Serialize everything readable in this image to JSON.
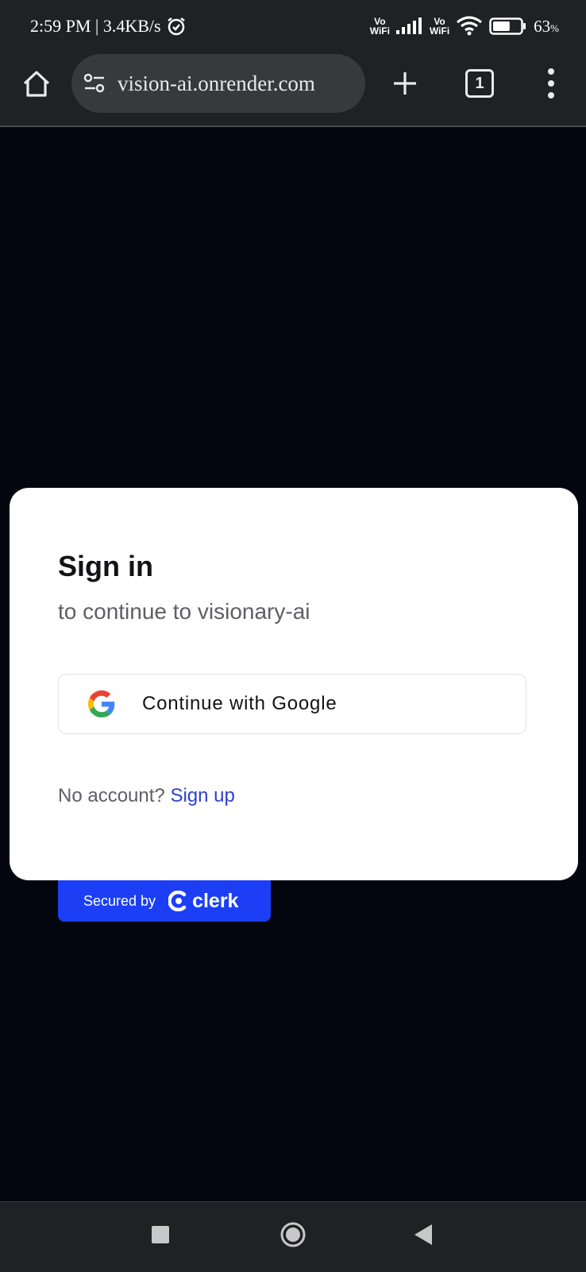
{
  "status_bar": {
    "time_speed": "2:59 PM | 3.4KB/s",
    "vowifi_1_top": "Vo",
    "vowifi_1_bottom": "WiFi",
    "vowifi_2_top": "Vo",
    "vowifi_2_bottom": "WiFi",
    "battery_percent": "63",
    "battery_unit": "%",
    "battery_level": 0.63,
    "icons": [
      "alarm-icon",
      "signal-icon",
      "wifi-icon",
      "battery-icon"
    ]
  },
  "browser": {
    "url": "vision-ai.onrender.com",
    "tab_count": "1",
    "icons": [
      "home-icon",
      "site-settings-icon",
      "new-tab-icon",
      "tab-switcher-icon",
      "more-menu-icon"
    ]
  },
  "sign_in": {
    "title": "Sign in",
    "subtitle": "to continue to visionary-ai",
    "google_button_label": "Continue with Google",
    "no_account_text": "No account?",
    "sign_up_link": "Sign up"
  },
  "secured_badge": {
    "label": "Secured by",
    "brand": "clerk"
  },
  "colors": {
    "page_background": "#04060f",
    "chrome_background": "#202124",
    "card_background": "#ffffff",
    "link": "#2f3fcf",
    "clerk_brand": "#1c3ff5"
  },
  "nav_bar": {
    "icons": [
      "recents-icon",
      "home-circle-icon",
      "back-icon"
    ]
  }
}
